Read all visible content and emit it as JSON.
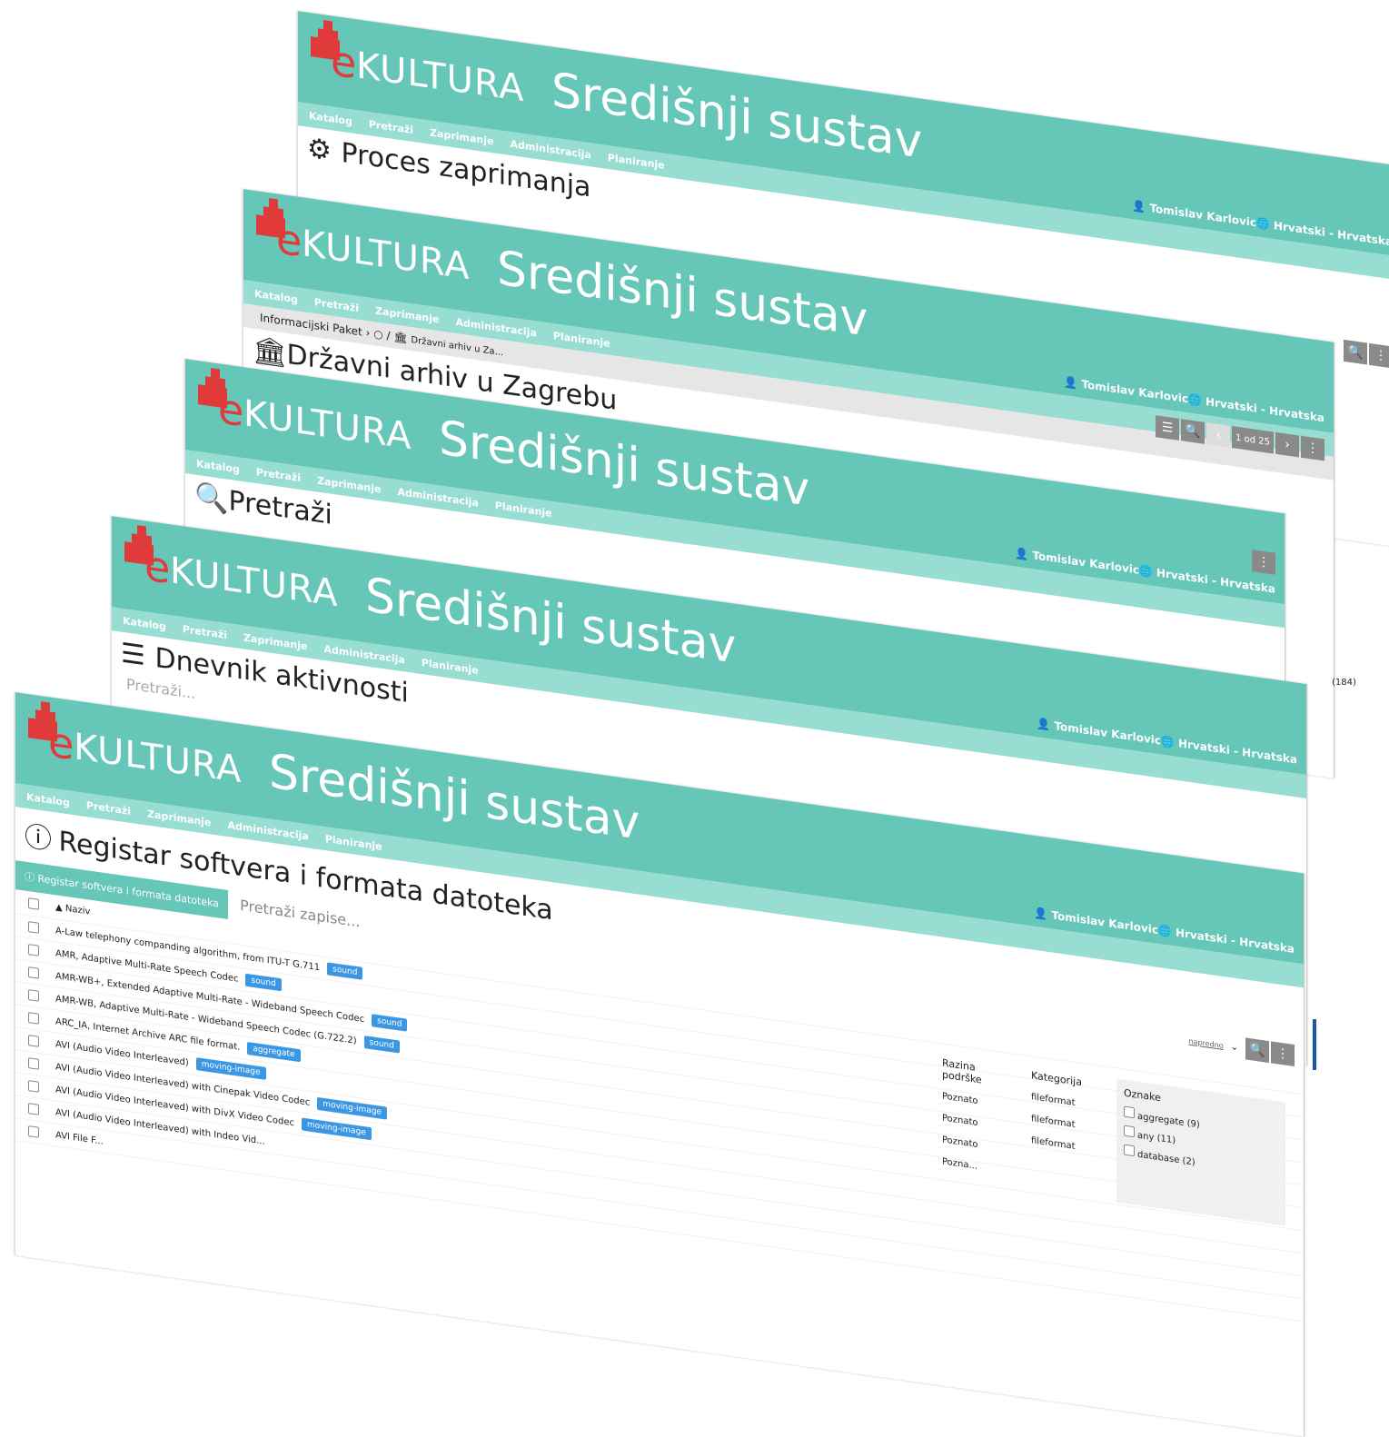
{
  "brand": {
    "e": "e",
    "kultura": "KULTURA",
    "system": "Središnji sustav"
  },
  "nav": [
    "Katalog",
    "Pretraži",
    "Zaprimanje",
    "Administracija",
    "Planiranje"
  ],
  "user": "Tomislav Karlovic",
  "language": "Hrvatski - Hrvatska",
  "windows": [
    {
      "title": "Proces zaprimanja",
      "icon": "gear-icon"
    },
    {
      "title": "Državni arhiv u Zagrebu",
      "icon": "institution-icon",
      "breadcrumb": {
        "root": "Informacijski Paket",
        "current": "Državni arhiv u Za..."
      },
      "pager": "1 od 25"
    },
    {
      "title": "Pretraži",
      "icon": "search-icon"
    },
    {
      "title": "Dnevnik aktivnosti",
      "icon": "receipt-icon",
      "search_placeholder": "Pretraži..."
    },
    {
      "title": "Registar softvera i formata datoteka",
      "icon": "info-icon"
    }
  ],
  "side_count": "(184)",
  "registry": {
    "tab": "Registar softvera i formata datoteka",
    "search_placeholder": "Pretraži zapise...",
    "advanced": "napredno",
    "col_name": "Naziv",
    "col_support": "Razina podrške",
    "col_category": "Kategorija",
    "rows": [
      {
        "name": "A-Law telephony companding algorithm, from ITU-T G.711",
        "tag": "sound"
      },
      {
        "name": "AMR, Adaptive Multi-Rate Speech Codec",
        "tag": "sound"
      },
      {
        "name": "AMR-WB+, Extended Adaptive Multi-Rate - Wideband Speech Codec",
        "tag": "sound"
      },
      {
        "name": "AMR-WB, Adaptive Multi-Rate - Wideband Speech Codec (G.722.2)",
        "tag": "sound"
      },
      {
        "name": "ARC_IA, Internet Archive ARC file format.",
        "tag": "aggregate"
      },
      {
        "name": "AVI (Audio Video Interleaved)",
        "tag": "moving-image"
      },
      {
        "name": "AVI (Audio Video Interleaved) with Cinepak Video Codec",
        "tag": "moving-image"
      },
      {
        "name": "AVI (Audio Video Interleaved) with DivX Video Codec",
        "tag": "moving-image"
      },
      {
        "name": "AVI (Audio Video Interleaved) with Indeo Vid...",
        "tag": ""
      },
      {
        "name": "AVI File F...",
        "tag": ""
      }
    ],
    "support_values": [
      "Poznato",
      "Poznato",
      "Poznato",
      "Pozna..."
    ],
    "category_values": [
      "fileformat",
      "fileformat",
      "fileformat"
    ],
    "tags_title": "Oznake",
    "tags": [
      "aggregate (9)",
      "any (11)",
      "database (2)"
    ]
  }
}
